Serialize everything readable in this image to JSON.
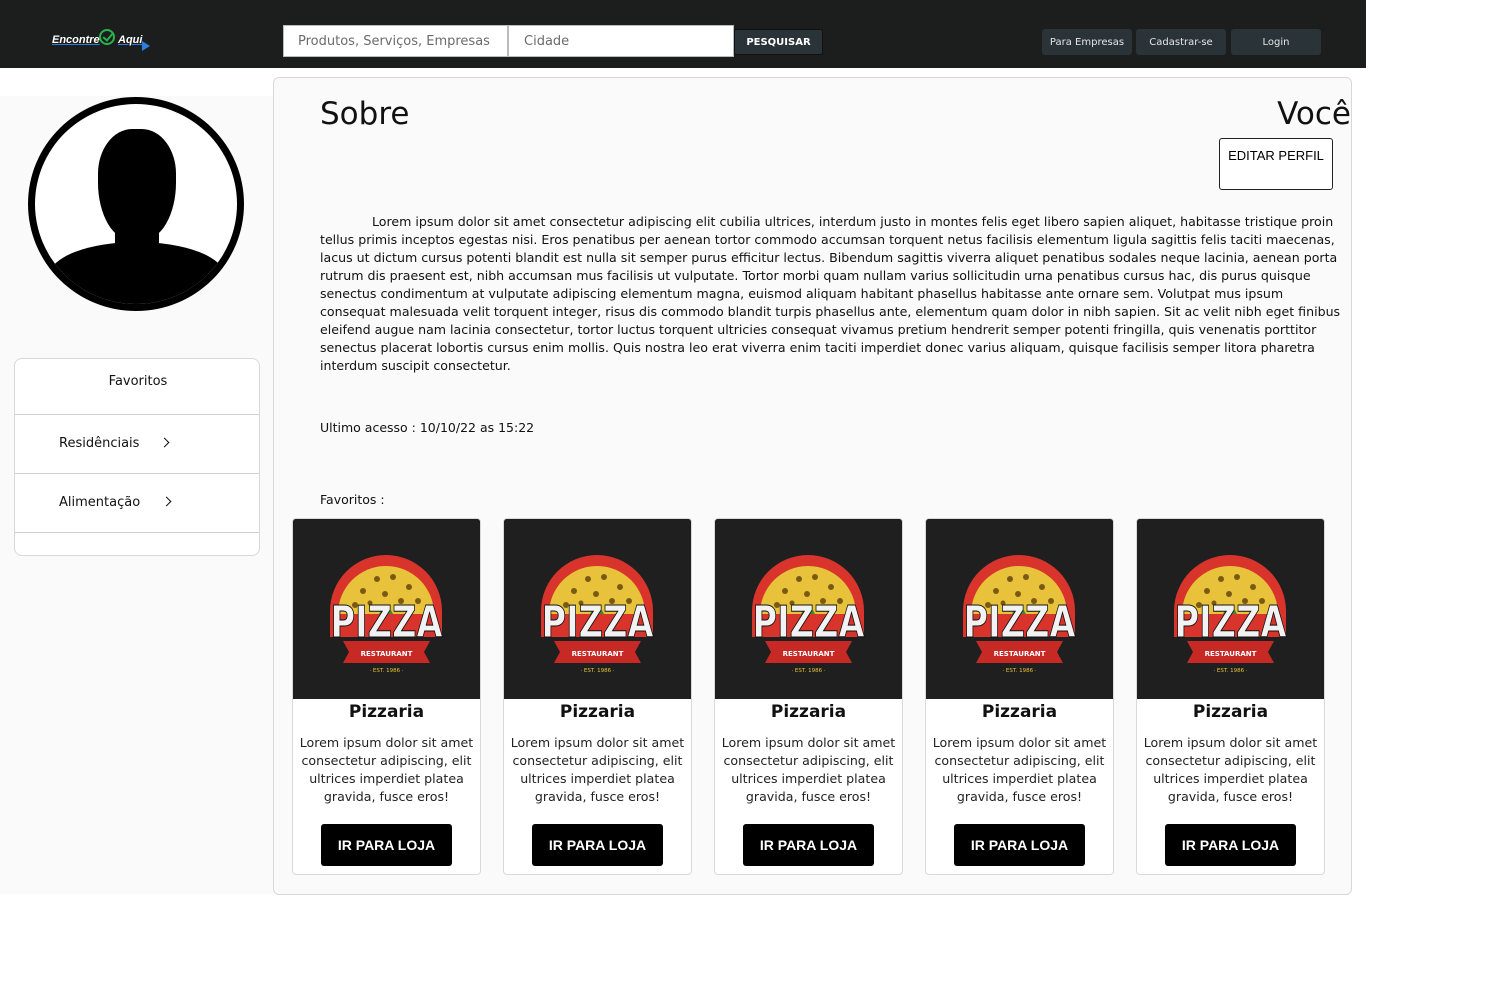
{
  "header": {
    "logo_word1": "Encontre",
    "logo_word2": "Aqui",
    "search_placeholder": "Produtos, Serviços, Empresas",
    "city_placeholder": "Cidade",
    "search_button": "PESQUISAR",
    "nav": {
      "business": "Para Empresas",
      "signup": "Cadastrar-se",
      "login": "Login"
    }
  },
  "sidebar": {
    "favorites_title": "Favoritos",
    "items": [
      {
        "label": "Residênciais"
      },
      {
        "label": "Alimentação"
      }
    ]
  },
  "profile": {
    "title_left": "Sobre",
    "title_right": "Você",
    "edit_button": "EDITAR PERFIL",
    "about": "Lorem ipsum dolor sit amet consectetur adipiscing elit cubilia ultrices, interdum justo in montes felis eget libero sapien aliquet, habitasse tristique proin tellus primis inceptos egestas nisi. Eros penatibus per aenean tortor commodo accumsan torquent netus facilisis elementum ligula sagittis felis taciti maecenas, lacus ut dictum cursus potenti blandit est nulla sit semper purus efficitur lectus. Bibendum sagittis viverra aliquet penatibus sodales neque lacinia, aenean porta rutrum dis praesent est, nibh accumsan mus facilisis ut vulputate. Tortor morbi quam nullam varius sollicitudin urna penatibus cursus hac, dis purus quisque senectus condimentum at vulputate adipiscing elementum magna, euismod aliquam habitant phasellus habitasse ante ornare sem. Volutpat mus ipsum consequat malesuada velit torquent integer, risus dis commodo blandit turpis phasellus ante, elementum quam dolor in nibh sapien. Sit ac velit nibh eget finibus eleifend augue nam lacinia consectetur, tortor luctus torquent ultricies consequat vivamus pretium hendrerit semper potenti fringilla, quis venenatis porttitor senectus placerat lobortis cursus enim mollis. Quis nostra leo erat viverra enim taciti imperdiet donec varius aliquam, quisque facilisis semper litora pharetra interdum suscipit consectetur.",
    "last_access": "Ultimo acesso : 10/10/22 as 15:22",
    "favorites_label": "Favoritos :"
  },
  "cards": [
    {
      "name": "Pizzaria",
      "desc": "Lorem ipsum dolor sit amet consectetur adipiscing, elit ultrices imperdiet platea gravida, fusce eros!",
      "button": "IR PARA LOJA",
      "logo_text": "PIZZA",
      "logo_ribbon": "RESTAURANT",
      "logo_est": "· EST. 1986 ·"
    },
    {
      "name": "Pizzaria",
      "desc": "Lorem ipsum dolor sit amet consectetur adipiscing, elit ultrices imperdiet platea gravida, fusce eros!",
      "button": "IR PARA LOJA",
      "logo_text": "PIZZA",
      "logo_ribbon": "RESTAURANT",
      "logo_est": "· EST. 1986 ·"
    },
    {
      "name": "Pizzaria",
      "desc": "Lorem ipsum dolor sit amet consectetur adipiscing, elit ultrices imperdiet platea gravida, fusce eros!",
      "button": "IR PARA LOJA",
      "logo_text": "PIZZA",
      "logo_ribbon": "RESTAURANT",
      "logo_est": "· EST. 1986 ·"
    },
    {
      "name": "Pizzaria",
      "desc": "Lorem ipsum dolor sit amet consectetur adipiscing, elit ultrices imperdiet platea gravida, fusce eros!",
      "button": "IR PARA LOJA",
      "logo_text": "PIZZA",
      "logo_ribbon": "RESTAURANT",
      "logo_est": "· EST. 1986 ·"
    },
    {
      "name": "Pizzaria",
      "desc": "Lorem ipsum dolor sit amet consectetur adipiscing, elit ultrices imperdiet platea gravida, fusce eros!",
      "button": "IR PARA LOJA",
      "logo_text": "PIZZA",
      "logo_ribbon": "RESTAURANT",
      "logo_est": "· EST. 1986 ·"
    }
  ],
  "colors": {
    "header_bg": "#1c1d1d",
    "nav_button_bg": "#2a3438",
    "panel_bg": "#fafafa",
    "pizza_red": "#d8342c",
    "pizza_yellow": "#e8c23a"
  }
}
